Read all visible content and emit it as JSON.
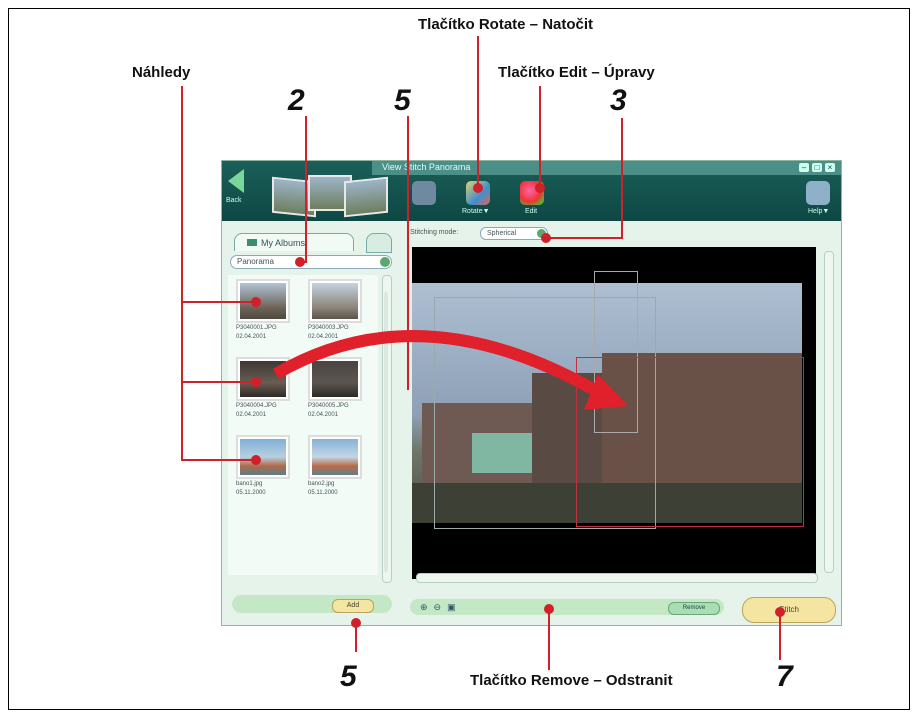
{
  "callouts": {
    "rotate": "Tlačítko Rotate – Natočit",
    "edit": "Tlačítko Edit – Úpravy",
    "nahledy": "Náhledy",
    "remove": "Tlačítko Remove – Odstranit"
  },
  "numbers": {
    "n2": "2",
    "n5_top": "5",
    "n3": "3",
    "n5_bottom": "5",
    "n7": "7"
  },
  "app": {
    "title": "View Stitch Panorama",
    "back_label": "Back",
    "toolbar": [
      {
        "label": "Rotate▼"
      },
      {
        "label": "Edit"
      }
    ],
    "help_label": "Help▼",
    "albums_tab": "My Albums",
    "album_dropdown": "Panorama",
    "thumbnails": [
      {
        "file": "P3040001.JPG",
        "date": "02.04.2001"
      },
      {
        "file": "P3040003.JPG",
        "date": "02.04.2001"
      },
      {
        "file": "P3040004.JPG",
        "date": "02.04.2001"
      },
      {
        "file": "P3040005.JPG",
        "date": "02.04.2001"
      },
      {
        "file": "bano1.jpg",
        "date": "05.11.2000"
      },
      {
        "file": "bano2.jpg",
        "date": "05.11.2000"
      }
    ],
    "add_label": "Add",
    "stitching_mode_label": "Stitching mode:",
    "stitching_mode_value": "Spherical",
    "remove_label": "Remove",
    "stitch_label": "Stitch"
  }
}
